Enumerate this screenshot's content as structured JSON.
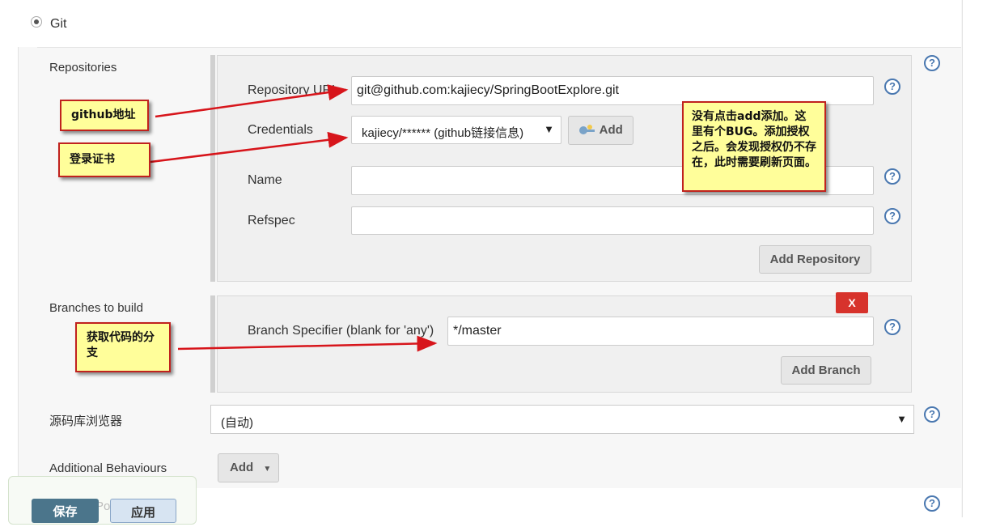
{
  "scm": {
    "option_label": "Git"
  },
  "repositories": {
    "section_label": "Repositories",
    "url_label": "Repository URL",
    "url_value": "git@github.com:kajiecy/SpringBootExplore.git",
    "credentials_label": "Credentials",
    "credentials_value": "kajiecy/****** (github链接信息)",
    "add_credential_label": "Add",
    "name_label": "Name",
    "name_value": "",
    "refspec_label": "Refspec",
    "refspec_value": "",
    "add_repository_label": "Add Repository"
  },
  "branches": {
    "section_label": "Branches to build",
    "delete_label": "X",
    "specifier_label": "Branch Specifier (blank for 'any')",
    "specifier_value": "*/master",
    "add_branch_label": "Add Branch"
  },
  "browser": {
    "section_label": "源码库浏览器",
    "selected": "(自动)"
  },
  "behaviours": {
    "section_label": "Additional Behaviours",
    "add_label": "Add"
  },
  "help_icon": "?",
  "callouts": {
    "github_address": "github地址",
    "credentials_note": "登录证书",
    "branch_note": "获取代码的分支",
    "bug_note": "没有点击add添加。这里有个BUG。添加授权之后。会发现授权仍不存在，此时需要刷新页面。"
  },
  "bottom": {
    "save_label": "保存",
    "apply_label": "应用",
    "hidden_label": "Po"
  },
  "colors": {
    "annotation_border": "#c0221e",
    "annotation_fill": "#fffe9a",
    "arrow": "#d7151b",
    "help_icon": "#4a78b0",
    "delete_button": "#d7332c"
  }
}
